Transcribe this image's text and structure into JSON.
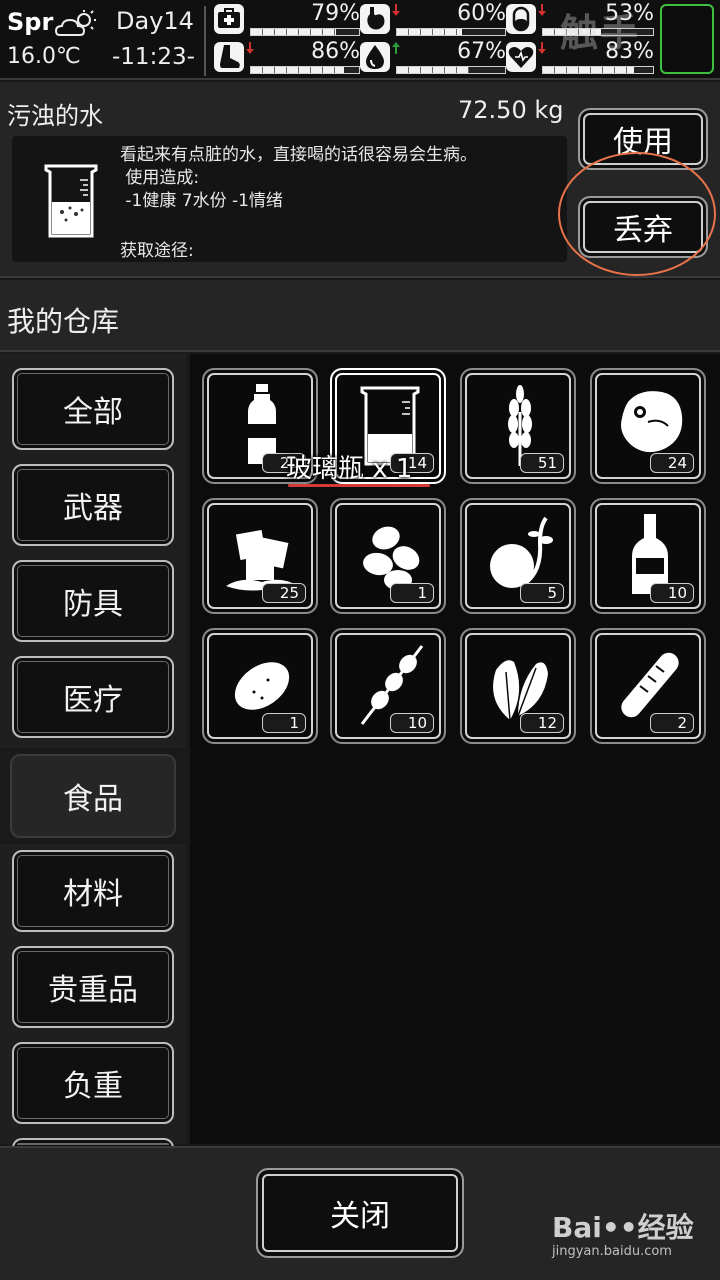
{
  "status": {
    "season": "Spr",
    "temperature": "16.0℃",
    "day": "Day14",
    "time": "-11:23-",
    "weather_icon": "partly-cloudy-icon",
    "stats": [
      {
        "name": "health",
        "icon": "first-aid-icon",
        "value": "79%",
        "level": 0.79,
        "arrow": ""
      },
      {
        "name": "hunger",
        "icon": "stomach-icon",
        "value": "60%",
        "level": 0.6,
        "arrow": "down",
        "arrow_color": "#d32f2f"
      },
      {
        "name": "energy",
        "icon": "pill-icon",
        "value": "53%",
        "level": 0.53,
        "arrow": "down",
        "arrow_color": "#d32f2f"
      },
      {
        "name": "stamina",
        "icon": "foot-icon",
        "value": "86%",
        "level": 0.86,
        "arrow": "down",
        "arrow_color": "#d32f2f"
      },
      {
        "name": "hydration",
        "icon": "water-drop-icon",
        "value": "67%",
        "level": 0.67,
        "arrow": "up",
        "arrow_color": "#2e9b3a"
      },
      {
        "name": "mood",
        "icon": "heart-icon",
        "value": "83%",
        "level": 0.83,
        "arrow": "down",
        "arrow_color": "#d32f2f"
      }
    ],
    "watermark": "触手"
  },
  "detail": {
    "name": "污浊的水",
    "weight": "72.50 kg",
    "description": "看起来有点脏的水，直接喝的话很容易会生病。\n 使用造成:\n -1健康 7水份 -1情绪",
    "source_label": "获取途径:",
    "use_label": "使用",
    "discard_label": "丢弃"
  },
  "warehouse": {
    "title": "我的仓库",
    "categories": [
      "全部",
      "武器",
      "防具",
      "医疗",
      "食品",
      "材料",
      "贵重品",
      "负重"
    ],
    "active_category": "食品",
    "items": [
      {
        "icon": "water-bottle-icon",
        "count": "20"
      },
      {
        "icon": "glass-jar-icon",
        "count": "14"
      },
      {
        "icon": "wheat-icon",
        "count": "51"
      },
      {
        "icon": "raw-meat-icon",
        "count": "24"
      },
      {
        "icon": "ice-cubes-icon",
        "count": "25"
      },
      {
        "icon": "nuts-icon",
        "count": "1"
      },
      {
        "icon": "fruit-sprout-icon",
        "count": "5"
      },
      {
        "icon": "liquor-bottle-icon",
        "count": "10"
      },
      {
        "icon": "potato-icon",
        "count": "1"
      },
      {
        "icon": "meat-skewer-icon",
        "count": "10"
      },
      {
        "icon": "leaves-icon",
        "count": "12"
      },
      {
        "icon": "bread-icon",
        "count": "2"
      }
    ],
    "tooltip": "玻璃瓶 x 1"
  },
  "footer": {
    "close_label": "关闭",
    "watermark": "Bai••经验",
    "watermark_sub": "jingyan.baidu.com"
  }
}
